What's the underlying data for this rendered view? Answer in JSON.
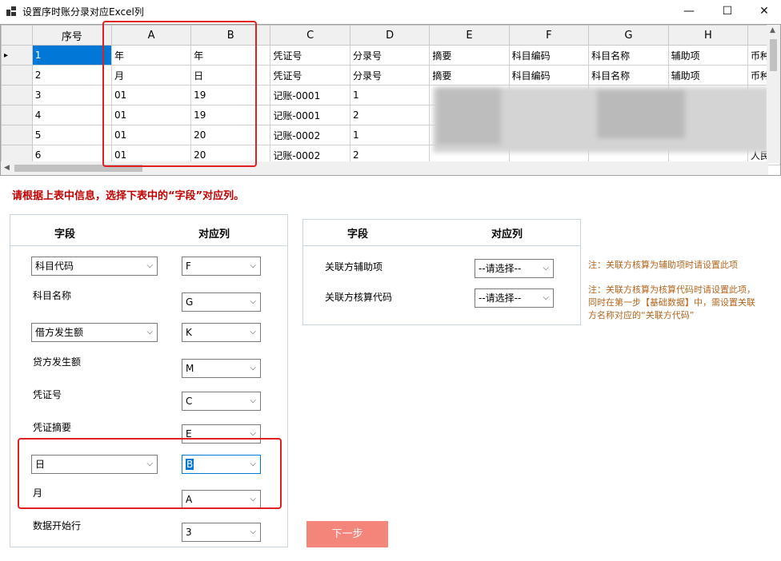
{
  "window": {
    "title": "设置序时账分录对应Excel列",
    "minimize": "—",
    "maximize": "☐",
    "close": "✕"
  },
  "grid": {
    "row_header_title": "序号",
    "columns": [
      "A",
      "B",
      "C",
      "D",
      "E",
      "F",
      "G",
      "H"
    ],
    "rows": [
      [
        "1",
        "年",
        "年",
        "凭证号",
        "分录号",
        "摘要",
        "科目编码",
        "科目名称",
        "辅助项",
        "币种"
      ],
      [
        "2",
        "月",
        "日",
        "凭证号",
        "分录号",
        "摘要",
        "科目编码",
        "科目名称",
        "辅助项",
        "币种"
      ],
      [
        "3",
        "01",
        "19",
        "记账-0001",
        "1",
        "",
        "",
        "",
        "",
        ""
      ],
      [
        "4",
        "01",
        "19",
        "记账-0001",
        "2",
        "",
        "",
        "",
        "",
        ""
      ],
      [
        "5",
        "01",
        "20",
        "记账-0002",
        "1",
        "",
        "",
        "",
        "",
        ""
      ],
      [
        "6",
        "01",
        "20",
        "记账-0002",
        "2",
        "",
        "",
        "",
        "",
        "人民"
      ]
    ]
  },
  "instruction": "请根据上表中信息，选择下表中的“字段”对应列。",
  "left_panel": {
    "field_header": "字段",
    "col_header": "对应列",
    "rows": [
      {
        "field": "科目代码",
        "field_is_combo": true,
        "col": "F"
      },
      {
        "field": "科目名称",
        "field_is_combo": false,
        "col": "G"
      },
      {
        "field": "借方发生额",
        "field_is_combo": true,
        "col": "K"
      },
      {
        "field": "贷方发生额",
        "field_is_combo": false,
        "col": "M"
      },
      {
        "field": "凭证号",
        "field_is_combo": false,
        "col": "C"
      },
      {
        "field": "凭证摘要",
        "field_is_combo": false,
        "col": "E"
      },
      {
        "field": "日",
        "field_is_combo": true,
        "col": "B"
      },
      {
        "field": "月",
        "field_is_combo": false,
        "col": "A"
      },
      {
        "field": "数据开始行",
        "field_is_combo": false,
        "col": "3"
      }
    ]
  },
  "right_panel": {
    "field_header": "字段",
    "col_header": "对应列",
    "rows": [
      {
        "field": "关联方辅助项",
        "col": "--请选择--"
      },
      {
        "field": "关联方核算代码",
        "col": "--请选择--"
      }
    ]
  },
  "notes": [
    "注：关联方核算为辅助项时请设置此项",
    "注：关联方核算为核算代码时请设置此项，同时在第一步【基础数据】中，需设置关联方名称对应的“关联方代码”"
  ],
  "next_button": "下一步",
  "colors": {
    "accent": "#0078d7",
    "highlight_box": "#e02020",
    "instruction": "#c00000",
    "note": "#b5651d",
    "next_button": "#f4857a"
  }
}
